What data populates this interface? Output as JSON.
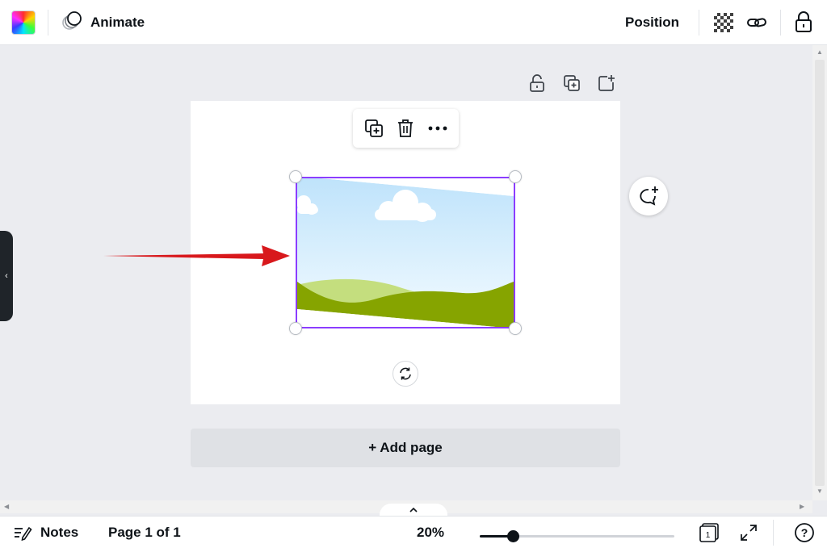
{
  "toolbar": {
    "animate_label": "Animate",
    "position_label": "Position",
    "icons": [
      "color-swatch",
      "animate-icon",
      "transparency-icon",
      "link-icon",
      "lock-icon"
    ]
  },
  "page_tools": {
    "icons": [
      "unlock-icon",
      "duplicate-page-icon",
      "add-page-icon"
    ]
  },
  "floating_toolbar": {
    "icons": [
      "copy-icon",
      "trash-icon",
      "more-icon"
    ]
  },
  "canvas": {
    "selection_color": "#8b3dff",
    "arrow_color": "#d8181c",
    "add_page_label": "+ Add page"
  },
  "bottombar": {
    "notes_label": "Notes",
    "page_indicator": "Page 1 of 1",
    "zoom_label": "20%",
    "zoom_fraction": 0.17,
    "page_count_badge": "1"
  },
  "colors": {
    "canvas_bg": "#ebecf0",
    "sky_top": "#bfe3fb",
    "grass_dark": "#86a400",
    "grass_light": "#c4de7e"
  }
}
